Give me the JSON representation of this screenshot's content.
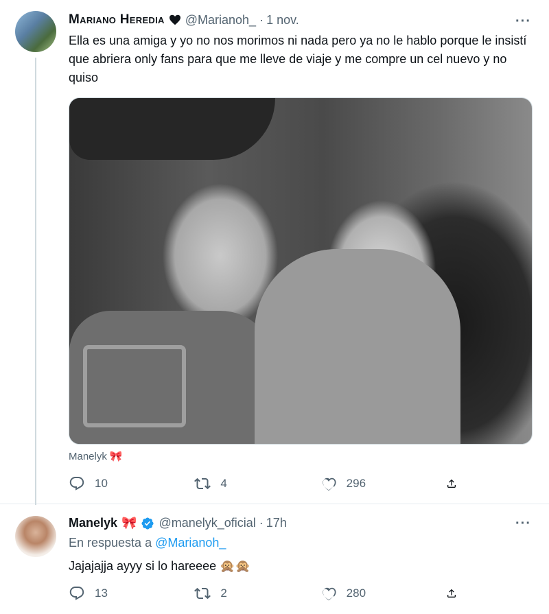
{
  "tweet1": {
    "author_name": "Mariano Heredia",
    "author_handle": "@Marianoh_",
    "separator": "·",
    "time": "1 nov.",
    "text": "Ella es una amiga y yo no nos morimos ni nada pero ya no le hablo porque le insistí que abriera only fans para que me lleve de viaje y me compre un cel nuevo y no quiso",
    "media_tag": "Manelyk",
    "media_tag_emoji": "🎀",
    "replies": "10",
    "retweets": "4",
    "likes": "296"
  },
  "tweet2": {
    "author_name": "Manelyk",
    "author_emoji": "🎀",
    "author_handle": "@manelyk_oficial",
    "separator": "·",
    "time": "17h",
    "reply_prefix": "En respuesta a",
    "reply_mention": "@Marianoh_",
    "text": "Jajajajja ayyy si lo hareeee 🙊🙊",
    "replies": "13",
    "retweets": "2",
    "likes": "280"
  },
  "icons": {
    "more": "more-horizontal-icon",
    "reply": "reply-icon",
    "retweet": "retweet-icon",
    "like": "heart-icon",
    "share": "share-icon",
    "verified": "verified-badge-icon"
  },
  "colors": {
    "accent": "#1d9bf0",
    "secondary_text": "#536471",
    "primary_text": "#0f1419"
  },
  "more_label": "···"
}
